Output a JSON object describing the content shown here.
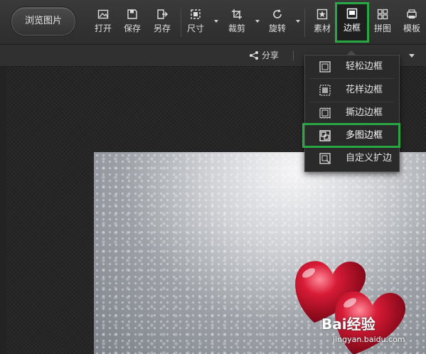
{
  "toolbar": {
    "browse_label": "浏览图片",
    "tools": [
      {
        "label": "打开",
        "icon": "open-image-icon"
      },
      {
        "label": "保存",
        "icon": "save-icon"
      },
      {
        "label": "另存",
        "icon": "save-as-icon"
      },
      {
        "label": "尺寸",
        "icon": "resize-icon"
      },
      {
        "label": "裁剪",
        "icon": "crop-icon"
      },
      {
        "label": "旋转",
        "icon": "rotate-icon"
      },
      {
        "label": "素材",
        "icon": "material-icon"
      },
      {
        "label": "边框",
        "icon": "frame-icon",
        "active": true
      },
      {
        "label": "拼图",
        "icon": "collage-icon"
      },
      {
        "label": "模板",
        "icon": "template-icon"
      }
    ]
  },
  "subbar": {
    "share_label": "分享"
  },
  "frame_menu": {
    "items": [
      {
        "label": "轻松边框",
        "icon": "simple-frame-icon"
      },
      {
        "label": "花样边框",
        "icon": "fancy-frame-icon"
      },
      {
        "label": "撕边边框",
        "icon": "torn-edge-frame-icon"
      },
      {
        "label": "多图边框",
        "icon": "multi-image-frame-icon",
        "selected": true
      },
      {
        "label": "自定义扩边",
        "icon": "custom-extend-icon"
      }
    ]
  },
  "watermark": {
    "brand": "Bai经验",
    "url": "jingyan.baidu.com"
  },
  "colors": {
    "highlight": "#27a844",
    "heart": "#c8102e"
  }
}
